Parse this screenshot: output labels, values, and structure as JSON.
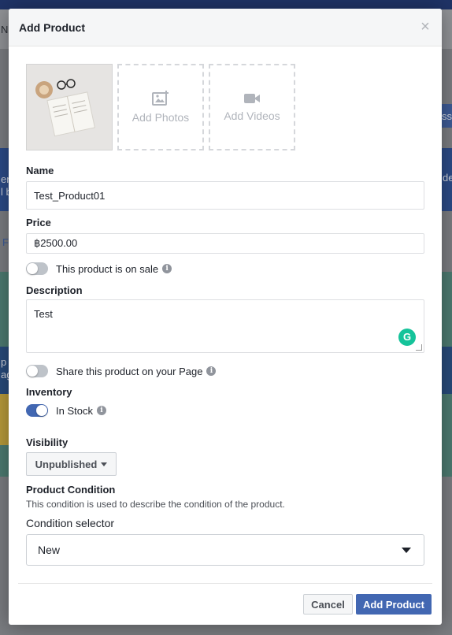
{
  "background": {
    "frag_top_left": "N",
    "frag_left1": "er",
    "frag_left2": "l b",
    "frag_left3": "F",
    "frag_left4": "p",
    "frag_left5": "ag",
    "frag_right1": "ssa",
    "frag_right2": "de"
  },
  "modal": {
    "title": "Add Product",
    "close_glyph": "×"
  },
  "media": {
    "add_photos_label": "Add Photos",
    "add_videos_label": "Add Videos"
  },
  "form": {
    "name_label": "Name",
    "name_value": "Test_Product01",
    "price_label": "Price",
    "price_value": "฿2500.00",
    "on_sale_label": "This product is on sale",
    "on_sale_enabled": false,
    "description_label": "Description",
    "description_value": "Test",
    "share_label": "Share this product on your Page",
    "share_enabled": false,
    "inventory_label": "Inventory",
    "in_stock_label": "In Stock",
    "in_stock_enabled": true,
    "visibility_label": "Visibility",
    "visibility_value": "Unpublished",
    "condition_heading": "Product Condition",
    "condition_note": "This condition is used to describe the condition of the product.",
    "condition_selector_label": "Condition selector",
    "condition_value": "New",
    "info_glyph": "i",
    "grammarly_glyph": "G"
  },
  "footer": {
    "cancel_label": "Cancel",
    "add_label": "Add Product"
  },
  "colors": {
    "accent": "#4267b2",
    "grammarly": "#15c39a"
  },
  "icons": [
    "close-icon",
    "add-photo-icon",
    "video-camera-icon",
    "info-icon",
    "grammarly-icon",
    "caret-down-icon",
    "select-arrow-icon"
  ]
}
